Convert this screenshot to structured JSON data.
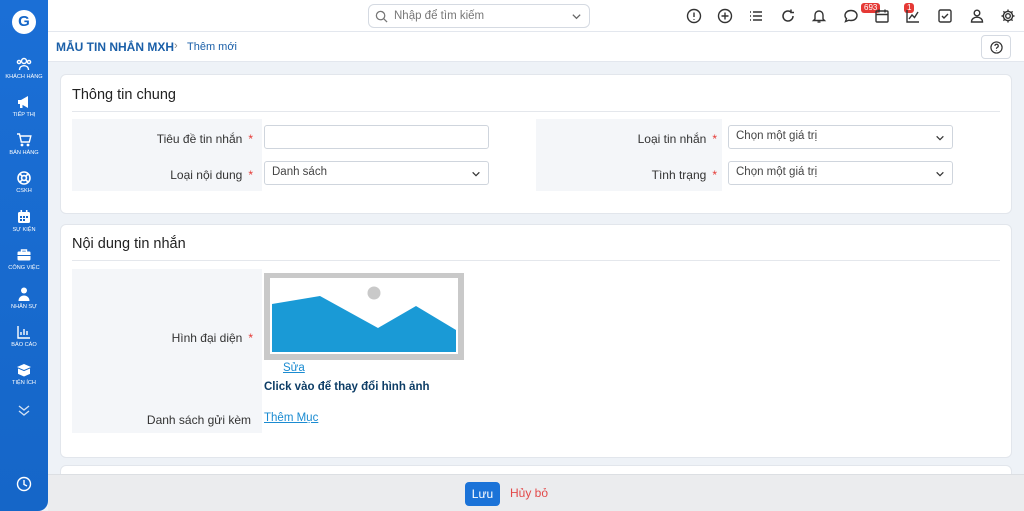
{
  "app": {
    "logo_glyph": "G",
    "accent": "#1566c8"
  },
  "sidebar": {
    "items": [
      {
        "label": "KHÁCH HÀNG",
        "icon": "users-icon"
      },
      {
        "label": "TIẾP THỊ",
        "icon": "megaphone-icon"
      },
      {
        "label": "BÁN HÀNG",
        "icon": "cart-icon"
      },
      {
        "label": "CSKH",
        "icon": "lifebuoy-icon"
      },
      {
        "label": "SỰ KIỆN",
        "icon": "calendar-icon"
      },
      {
        "label": "CÔNG VIỆC",
        "icon": "briefcase-icon"
      },
      {
        "label": "NHÂN SỰ",
        "icon": "person-icon"
      },
      {
        "label": "BÁO CÁO",
        "icon": "bar-chart-icon"
      },
      {
        "label": "TIỆN ÍCH",
        "icon": "box-icon"
      }
    ]
  },
  "topbar": {
    "search_placeholder": "Nhập để tìm kiếm",
    "notifications_count": "693",
    "messages_count": "1"
  },
  "breadcrumb": {
    "main": "MẪU TIN NHẮN MXH",
    "separator": "›",
    "current": "Thêm mới"
  },
  "general": {
    "title": "Thông tin chung",
    "fields": {
      "title_label": "Tiêu đề tin nhắn",
      "title_value": "",
      "content_type_label": "Loại nội dung",
      "content_type_value": "Danh sách",
      "message_type_label": "Loại tin nhắn",
      "message_type_value": "Chọn một giá trị",
      "status_label": "Tình trạng",
      "status_value": "Chọn một giá trị",
      "required_mark": "*"
    }
  },
  "content": {
    "title": "Nội dung tin nhắn",
    "avatar_label": "Hình đại diện",
    "edit_link": "Sửa",
    "change_hint": "Click vào để thay đổi hình ảnh",
    "attachments_label": "Danh sách gửi kèm",
    "add_item_link": "Thêm Mục",
    "required_mark": "*"
  },
  "actions": {
    "save": "Lưu",
    "cancel": "Hủy bỏ"
  }
}
